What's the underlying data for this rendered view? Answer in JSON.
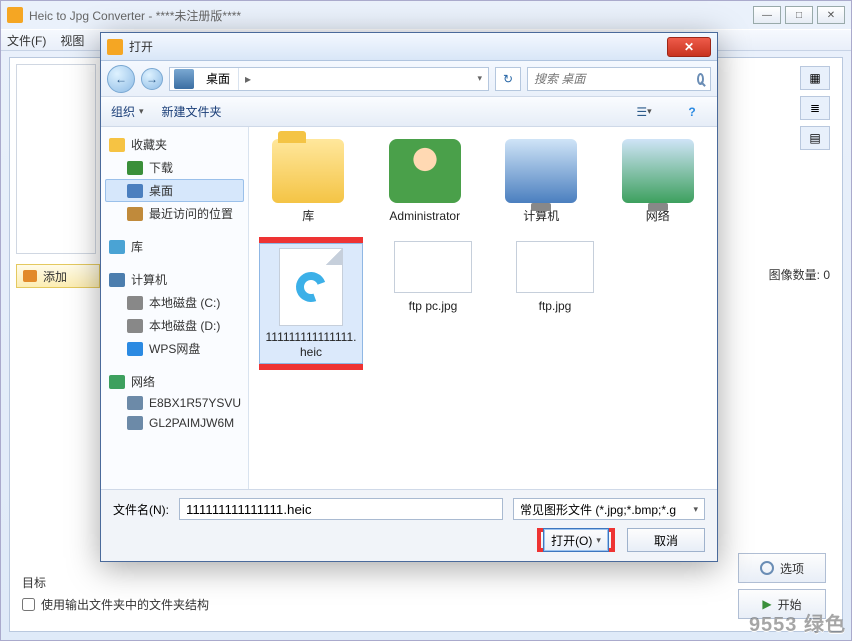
{
  "app": {
    "title": "Heic to Jpg Converter - ****未注册版****",
    "menu": {
      "file": "文件(F)",
      "view": "视图"
    },
    "add_images": "添加",
    "image_count_label": "图像数量:",
    "image_count_value": "0",
    "target_label": "目标",
    "use_source_structure": "使用输出文件夹中的文件夹结构",
    "options_btn": "选项",
    "start_btn": "开始",
    "win": {
      "min": "—",
      "max": "□",
      "close": "✕"
    }
  },
  "dialog": {
    "title": "打开",
    "nav": {
      "back": "←",
      "fwd": "→",
      "refresh": "↻"
    },
    "breadcrumb": {
      "seg1": "桌面",
      "arrow": "▸"
    },
    "search_placeholder": "搜索 桌面",
    "toolbar": {
      "organize": "组织",
      "new_folder": "新建文件夹"
    },
    "tree": {
      "favorites": "收藏夹",
      "downloads": "下载",
      "desktop": "桌面",
      "recent": "最近访问的位置",
      "libraries": "库",
      "computer": "计算机",
      "disk_c": "本地磁盘 (C:)",
      "disk_d": "本地磁盘 (D:)",
      "wps": "WPS网盘",
      "network": "网络",
      "node1": "E8BX1R57YSVU",
      "node2": "GL2PAIMJW6M"
    },
    "files": {
      "library": "库",
      "admin": "Administrator",
      "computer": "计算机",
      "network": "网络",
      "heic": "111111111111111.heic",
      "ftp_pc": "ftp pc.jpg",
      "ftp": "ftp.jpg"
    },
    "filename_label": "文件名(N):",
    "filename_value": "111111111111111.heic",
    "filter_text": "常见图形文件 (*.jpg;*.bmp;*.g",
    "open_btn": "打开(O)",
    "cancel_btn": "取消"
  },
  "watermark": "9553 绿色"
}
